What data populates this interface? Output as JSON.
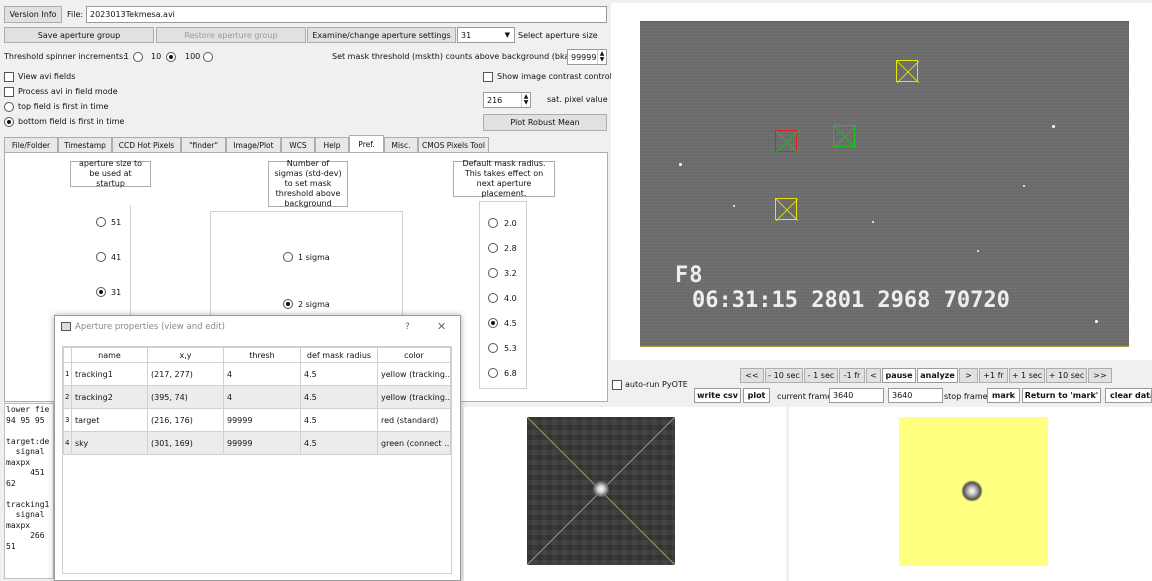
{
  "top": {
    "version_info": "Version Info",
    "file_label": "File:",
    "file_value": "2023013Tekmesa.avi",
    "save_group": "Save aperture group",
    "restore_group": "Restore aperture group",
    "examine_settings": "Examine/change aperture settings",
    "aperture_size_value": "31",
    "select_aperture_size": "Select aperture size",
    "threshold_label": "Threshold spinner increments:",
    "threshold_options": [
      "1",
      "10",
      "100"
    ],
    "threshold_selected": "10",
    "mask_threshold_label": "Set mask threshold (mskth) counts above background (bkavg)",
    "mask_threshold_value": "99999",
    "view_avi_fields": "View avi fields",
    "process_field_mode": "Process avi in field mode",
    "top_field_first": "top field is first in time",
    "bottom_field_first": "bottom field is first in time",
    "show_contrast": "Show image contrast control",
    "sat_value": "216",
    "sat_label": "sat. pixel value",
    "plot_robust_mean": "Plot Robust Mean"
  },
  "tabs": [
    "File/Folder",
    "Timestamp",
    "CCD Hot Pixels",
    "\"finder\"",
    "Image/Plot",
    "WCS",
    "Help",
    "Pref.",
    "Misc.",
    "CMOS Pixels Tool"
  ],
  "active_tab": "Pref.",
  "pref": {
    "aperture_startup_label": "aperture size to be used at startup",
    "aperture_sizes": [
      "51",
      "41",
      "31"
    ],
    "aperture_selected": "31",
    "sigma_label": "Number of sigmas (std-dev) to set mask threshold above background",
    "sigma_options": [
      "1 sigma",
      "2 sigma"
    ],
    "sigma_selected": "2 sigma",
    "mask_radius_label": "Default mask radius. This takes effect on next aperture placement.",
    "mask_radii": [
      "2.0",
      "2.8",
      "3.2",
      "4.0",
      "4.5",
      "5.3",
      "6.8"
    ],
    "mask_radius_selected": "4.5"
  },
  "dialog": {
    "title": "Aperture properties (view and edit)",
    "help": "?",
    "close": "✕",
    "columns": [
      "name",
      "x,y",
      "thresh",
      "def mask radius",
      "color"
    ],
    "rows": [
      {
        "n": "1",
        "name": "tracking1",
        "xy": "(217, 277)",
        "thresh": "4",
        "radius": "4.5",
        "color": "yellow (tracking..."
      },
      {
        "n": "2",
        "name": "tracking2",
        "xy": "(395, 74)",
        "thresh": "4",
        "radius": "4.5",
        "color": "yellow (tracking..."
      },
      {
        "n": "3",
        "name": "target",
        "xy": "(216, 176)",
        "thresh": "99999",
        "radius": "4.5",
        "color": "red (standard)"
      },
      {
        "n": "4",
        "name": "sky",
        "xy": "(301, 169)",
        "thresh": "99999",
        "radius": "4.5",
        "color": "green (connect ..."
      }
    ]
  },
  "log_text": "lower fie\n94 95 95\n\ntarget:de\n  signal\nmaxpx\n     451\n62\n\ntracking1\n  signal\nmaxpx\n     266\n51",
  "video": {
    "overlay_line1": "F8",
    "overlay_line2": "06:31:15 2801 2968 70720"
  },
  "playback": {
    "buttons": [
      "<<",
      "- 10 sec",
      "- 1 sec",
      "-1 fr",
      "<",
      "pause",
      "analyze",
      ">",
      "+1 fr",
      "+ 1 sec",
      "+ 10 sec",
      ">>"
    ],
    "auto_run": "auto-run PyOTE",
    "write_csv": "write csv",
    "plot": "plot",
    "current_frame_label": "current frame",
    "current_frame": "3640",
    "stop_frame_value": "3640",
    "stop_frame_label": "stop frame",
    "mark": "mark",
    "return_mark": "Return to 'mark'",
    "clear_data": "clear data"
  },
  "colors": {
    "yellow_ap": "#e6e600",
    "red_ap": "#e02020",
    "green_ap": "#20c020",
    "mask_bg": "#ffff80"
  }
}
